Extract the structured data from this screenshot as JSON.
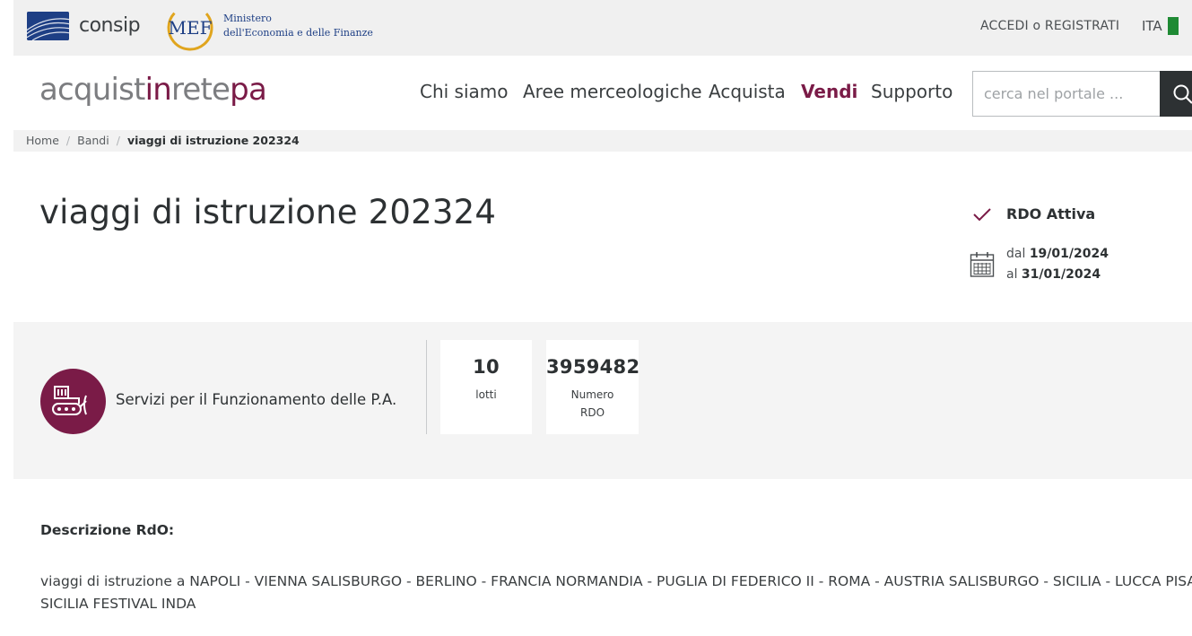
{
  "topbar": {
    "consip_label": "consip",
    "mef_logo_text": "MEF",
    "mef_line1": "Ministero",
    "mef_line2": "dell'Economia e delle Finanze",
    "login_label": "ACCEDI o REGISTRATI",
    "language_label": "ITA"
  },
  "header": {
    "brand_part1": "acquist",
    "brand_part2": "in",
    "brand_part3": "rete",
    "brand_part4": "pa",
    "nav": [
      {
        "label": "Chi siamo"
      },
      {
        "label": "Aree merceologiche"
      },
      {
        "label": "Acquista"
      },
      {
        "label": "Vendi"
      },
      {
        "label": "Supporto"
      }
    ],
    "search_placeholder": "cerca nel portale ..."
  },
  "breadcrumb": {
    "items": [
      "Home",
      "Bandi"
    ],
    "separator": "/",
    "current": "viaggi di istruzione 202324"
  },
  "tender": {
    "title": "viaggi di istruzione 202324",
    "status": "RDO Attiva",
    "date_from_prefix": "dal",
    "date_from": "19/01/2024",
    "date_to_prefix": "al",
    "date_to": "31/01/2024"
  },
  "info": {
    "category_label": "Servizi per il Funzionamento delle P.A.",
    "lots_value": "10",
    "lots_label": "lotti",
    "rdo_value": "3959482",
    "rdo_label_line1": "Numero",
    "rdo_label_line2": "RDO"
  },
  "description": {
    "heading": "Descrizione RdO:",
    "line1": "viaggi di istruzione a NAPOLI - VIENNA SALISBURGO - BERLINO - FRANCIA NORMANDIA - PUGLIA DI FEDERICO II - ROMA - AUSTRIA SALISBURGO - SICILIA - LUCCA PISA",
    "line2": "SICILIA FESTIVAL INDA"
  },
  "colors": {
    "brand_accent": "#7a1b47",
    "consip_blue": "#1e3f85",
    "flag_green": "#1f8a34"
  }
}
